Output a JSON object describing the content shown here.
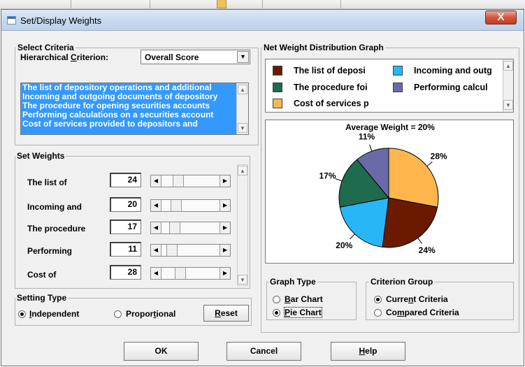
{
  "window": {
    "title": "Set/Display Weights",
    "close_glyph": "X"
  },
  "select_criteria": {
    "group_label": "Select Criteria",
    "hierarchical_label_pre": "Hierarchical ",
    "hierarchical_label_accel": "C",
    "hierarchical_label_post": "riterion:",
    "selected_value": "Overall Score",
    "list_items": [
      "The list of depository operations and additional",
      "Incoming and outgoing documents of depository",
      "The procedure for opening securities accounts",
      "Performing calculations on a securities account",
      "Cost of services provided to depositors and"
    ]
  },
  "set_weights": {
    "group_label": "Set Weights",
    "rows": [
      {
        "label": "The list of",
        "value": "24",
        "level": 0.24
      },
      {
        "label": "Incoming and",
        "value": "20",
        "level": 0.2
      },
      {
        "label": "The procedure",
        "value": "17",
        "level": 0.17
      },
      {
        "label": "Performing",
        "value": "11",
        "level": 0.11
      },
      {
        "label": "Cost of",
        "value": "28",
        "level": 0.28
      }
    ]
  },
  "setting_type": {
    "group_label": "Setting Type",
    "independent_accel": "I",
    "independent_rest": "ndependent",
    "proportional_pre": "Propor",
    "proportional_accel": "t",
    "proportional_post": "ional",
    "selected": "independent",
    "reset_accel": "R",
    "reset_rest": "eset"
  },
  "graph": {
    "group_label": "Net Weight Distribution Graph",
    "legend": [
      {
        "label": "The list of deposi",
        "color": "#6b1a00"
      },
      {
        "label": "Incoming and outg",
        "color": "#29b6f6"
      },
      {
        "label": "The procedure foi",
        "color": "#1e6b4e"
      },
      {
        "label": "Performing calcul",
        "color": "#6a6aa8"
      },
      {
        "label": "Cost of services p",
        "color": "#ffb74d"
      }
    ]
  },
  "chart_data": {
    "type": "pie",
    "title": "Average Weight = 20%",
    "slices": [
      {
        "label": "The list of depository operations and additional",
        "value": 24,
        "data_label": "24%",
        "color": "#6b1a00"
      },
      {
        "label": "Incoming and outgoing documents of depository",
        "value": 20,
        "data_label": "20%",
        "color": "#29b6f6"
      },
      {
        "label": "The procedure for opening securities accounts",
        "value": 17,
        "data_label": "17%",
        "color": "#1e6b4e"
      },
      {
        "label": "Performing calculations on a securities account",
        "value": 11,
        "data_label": "11%",
        "color": "#6a6aa8"
      },
      {
        "label": "Cost of services provided to depositors and",
        "value": 28,
        "data_label": "28%",
        "color": "#ffb74d"
      }
    ]
  },
  "graph_type": {
    "group_label": "Graph Type",
    "bar_accel": "B",
    "bar_rest": "ar Chart",
    "pie_accel": "P",
    "pie_rest": "ie Chart",
    "selected": "pie"
  },
  "criterion_group": {
    "group_label": "Criterion Group",
    "current_pre": "Curre",
    "current_accel": "n",
    "current_post": "t Criteria",
    "compared_pre": "Co",
    "compared_accel": "m",
    "compared_post": "pared Criteria",
    "selected": "current"
  },
  "buttons": {
    "ok": "OK",
    "cancel": "Cancel",
    "help_accel": "H",
    "help_rest": "elp"
  }
}
